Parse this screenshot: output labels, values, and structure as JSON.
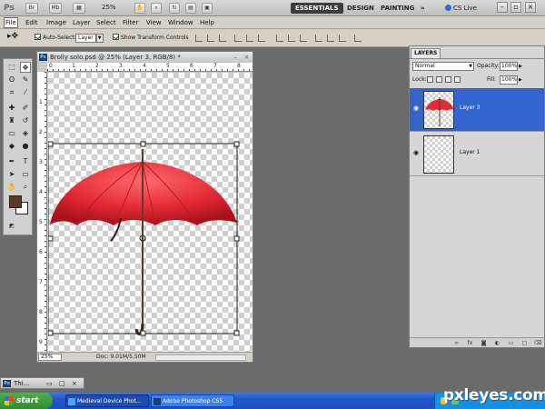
{
  "appbar": {
    "logo": "Ps",
    "zoom": "25%",
    "workspaces": [
      "ESSENTIALS",
      "DESIGN",
      "PAINTING"
    ],
    "more": "»",
    "cslive": "CS Live",
    "minimize": "–",
    "restore": "▫",
    "close": "×"
  },
  "menu": [
    "File",
    "Edit",
    "Image",
    "Layer",
    "Select",
    "Filter",
    "View",
    "Window",
    "Help"
  ],
  "options": {
    "auto_select_label": "Auto-Select:",
    "auto_select_value": "Layer",
    "transform_controls_label": "Show Transform Controls"
  },
  "document": {
    "title": "Brolly solo.psd @ 25% (Layer 3, RGB/8) *",
    "ruler_h_labels": [
      "0",
      "1",
      "2",
      "3",
      "4",
      "5",
      "6",
      "7",
      "8"
    ],
    "ruler_v_labels": [
      "1",
      "2",
      "3",
      "4",
      "5",
      "6",
      "7",
      "8",
      "9"
    ],
    "zoom_value": "25%",
    "doc_info": "Doc: 9.01M/5.50M"
  },
  "minimized_window": {
    "title": "Thi..."
  },
  "layers_panel": {
    "tab": "LAYERS",
    "blend_mode": "Normal",
    "opacity_label": "Opacity:",
    "opacity_value": "100%",
    "lock_label": "Lock:",
    "fill_label": "Fill:",
    "fill_value": "100%",
    "layers": [
      {
        "name": "Layer 3",
        "selected": true,
        "visible": true
      },
      {
        "name": "Layer 1",
        "selected": false,
        "visible": true
      }
    ]
  },
  "taskbar": {
    "start": "start",
    "buttons": [
      "Medieval Device Phot...",
      "Adobe Photoshop CS5"
    ],
    "watermark": "pxleyes.com"
  },
  "colors": {
    "selected_layer": "#3366cc",
    "foreground_swatch": "#5a3a2a",
    "umbrella_red": "#e32a35",
    "taskbar_blue": "#1f56c7"
  }
}
